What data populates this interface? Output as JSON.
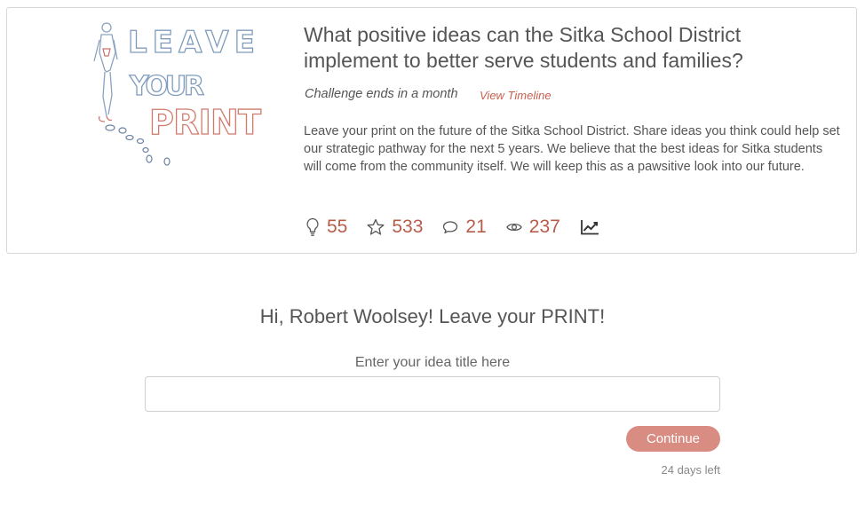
{
  "challenge": {
    "logo_text": [
      "LEAVE",
      "YOUR",
      "PRINT"
    ],
    "title": "What positive ideas can the Sitka School District implement to better serve students and families?",
    "deadline": "Challenge ends in a month",
    "timeline_link": "View Timeline",
    "description": "Leave your print on the future of the Sitka School District. Share ideas you think could help set our strategic pathway for the next 5 years. We believe that the best ideas for Sitka students will come from the community itself. We will keep this as a pawsitive look into our future.",
    "stats": {
      "ideas": "55",
      "votes": "533",
      "comments": "21",
      "views": "237"
    },
    "accent_color": "#b85c4a"
  },
  "form": {
    "greeting": "Hi, Robert Woolsey! Leave your PRINT!",
    "idea_label": "Enter your idea title here",
    "idea_value": "",
    "continue_label": "Continue",
    "days_left": "24 days left",
    "button_color": "#d98c82"
  }
}
